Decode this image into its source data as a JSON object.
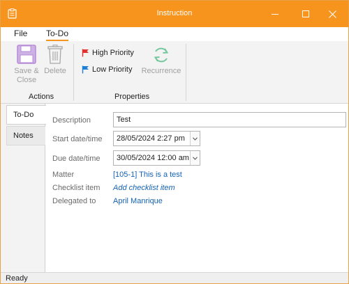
{
  "window": {
    "title": "Instruction"
  },
  "menu": {
    "tabs": [
      {
        "label": "File"
      },
      {
        "label": "To-Do"
      }
    ]
  },
  "ribbon": {
    "actions": {
      "save_close_label_line1": "Save &",
      "save_close_label_line2": "Close",
      "delete_label": "Delete",
      "group_label": "Actions"
    },
    "properties": {
      "high_priority_label": "High Priority",
      "low_priority_label": "Low Priority",
      "recurrence_label": "Recurrence",
      "group_label": "Properties"
    }
  },
  "side_tabs": [
    {
      "label": "To-Do"
    },
    {
      "label": "Notes"
    }
  ],
  "form": {
    "description_label": "Description",
    "description_value": "Test",
    "start_label": "Start date/time",
    "start_value": "28/05/2024 2:27 pm",
    "due_label": "Due date/time",
    "due_value": "30/05/2024 12:00 am",
    "matter_label": "Matter",
    "matter_value": "[105-1] This is a test",
    "checklist_label": "Checklist item",
    "checklist_value": "Add checklist item",
    "delegated_label": "Delegated to",
    "delegated_value": "April Manrique"
  },
  "status": {
    "text": "Ready"
  },
  "colors": {
    "accent": "#f7941d",
    "link": "#1463b5",
    "high_priority_flag": "#e0312f",
    "low_priority_flag": "#1e7fd6",
    "save_icon": "#b78ad6",
    "recurrence_icon": "#74c69d"
  },
  "icons": {
    "app": "clipboard-icon",
    "save_close": "floppy-disk-icon",
    "delete": "trash-icon",
    "high_priority": "red-flag-icon",
    "low_priority": "blue-flag-icon",
    "recurrence": "refresh-cycle-icon",
    "dropdown": "chevron-down-icon"
  }
}
